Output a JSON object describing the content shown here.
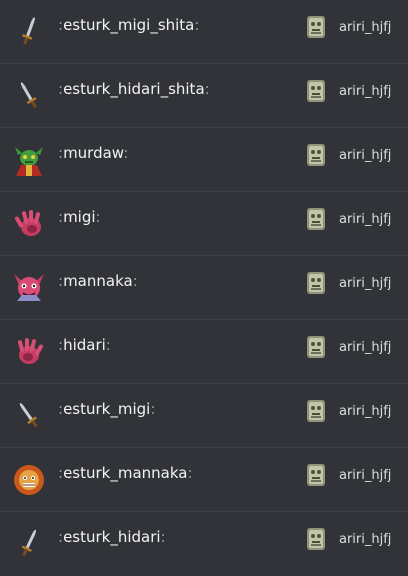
{
  "emojis": [
    {
      "name": "esturk_migi_shita",
      "icon": "dagger-icon",
      "uploader": "ariri_hjfj"
    },
    {
      "name": "esturk_hidari_shita",
      "icon": "dagger-icon",
      "uploader": "ariri_hjfj"
    },
    {
      "name": "murdaw",
      "icon": "green-demon-icon",
      "uploader": "ariri_hjfj"
    },
    {
      "name": "migi",
      "icon": "claw-hand-icon",
      "uploader": "ariri_hjfj"
    },
    {
      "name": "mannaka",
      "icon": "horned-demon-face-icon",
      "uploader": "ariri_hjfj"
    },
    {
      "name": "hidari",
      "icon": "claw-hand-icon",
      "uploader": "ariri_hjfj"
    },
    {
      "name": "esturk_migi",
      "icon": "dagger-icon",
      "uploader": "ariri_hjfj"
    },
    {
      "name": "esturk_mannaka",
      "icon": "lion-face-icon",
      "uploader": "ariri_hjfj"
    },
    {
      "name": "esturk_hidari",
      "icon": "dagger-icon",
      "uploader": "ariri_hjfj"
    }
  ],
  "colon": ":",
  "colors": {
    "background": "#313338",
    "divider": "#3f4147",
    "text": "#f2f3f5",
    "muted": "#949ba4"
  }
}
